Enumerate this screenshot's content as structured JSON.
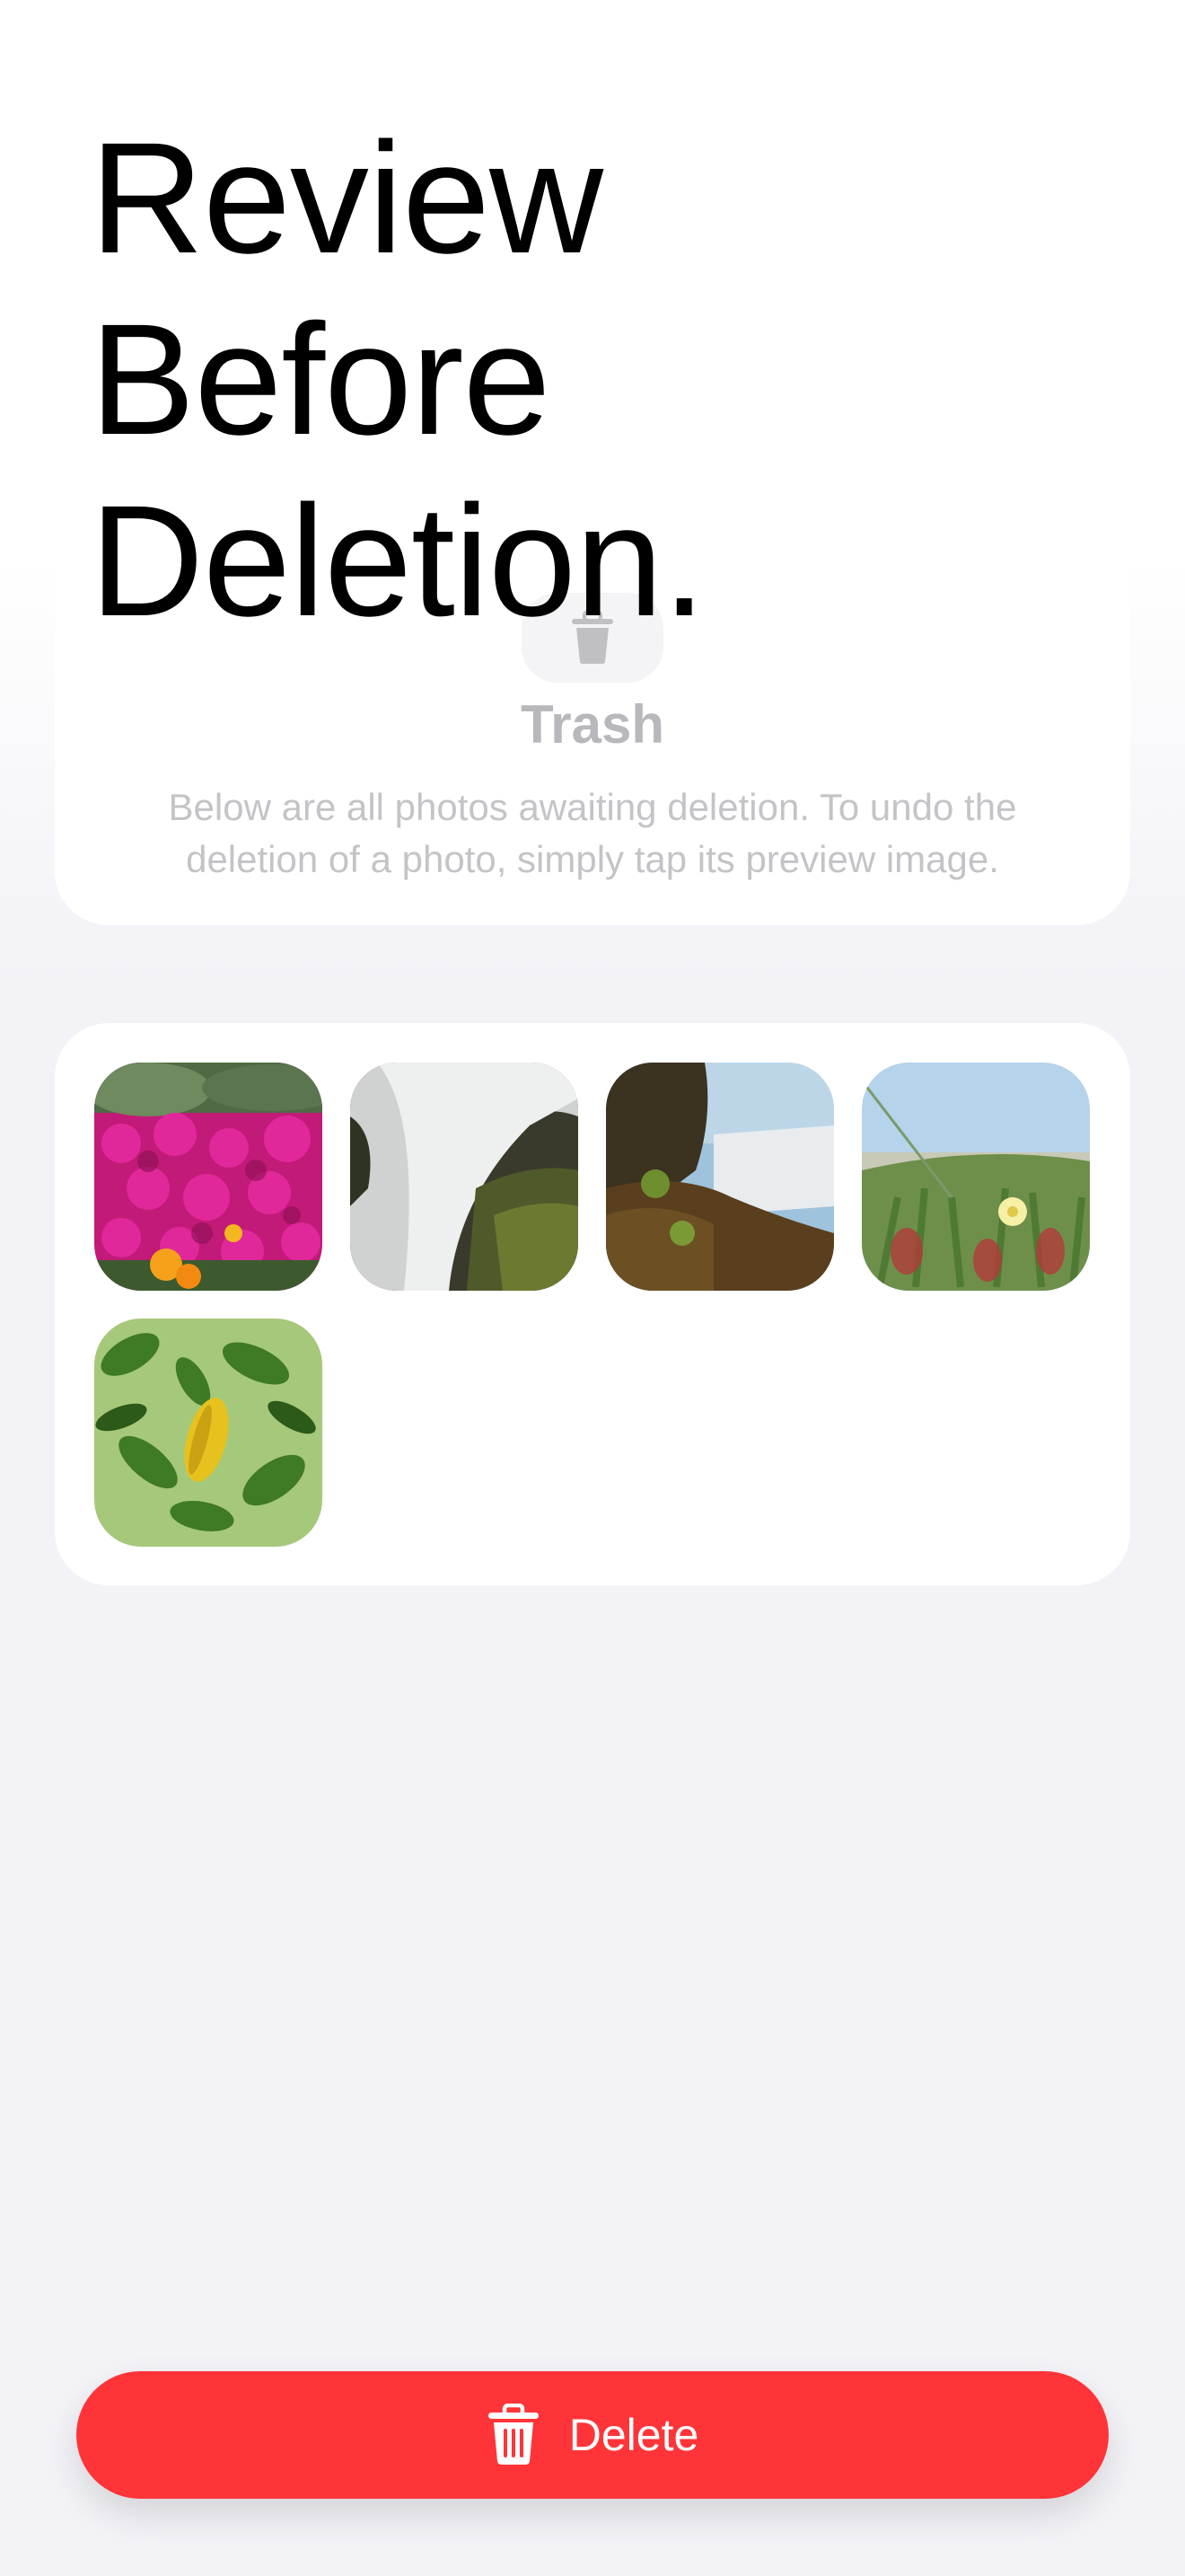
{
  "headline": {
    "line1": "Review",
    "line2": "Before",
    "line3": "Deletion."
  },
  "trash_card": {
    "icon": "trash-icon",
    "title": "Trash",
    "description": "Below are all photos awaiting deletion. To undo the deletion of a photo, simply tap its preview image."
  },
  "photos": [
    {
      "subject": "magenta flower field",
      "icon": "photo-thumbnail"
    },
    {
      "subject": "waterfall over mossy rocks",
      "icon": "photo-thumbnail"
    },
    {
      "subject": "waterfall cliff landscape",
      "icon": "photo-thumbnail"
    },
    {
      "subject": "yellow flower among succulents",
      "icon": "photo-thumbnail"
    },
    {
      "subject": "green leaves with yellow leaf",
      "icon": "photo-thumbnail"
    }
  ],
  "delete_button": {
    "icon": "trash-icon",
    "label": "Delete",
    "color": "#ff3439"
  },
  "colors": {
    "background": "#f2f2f7",
    "card": "#ffffff",
    "muted_text": "#c4c4c8"
  }
}
